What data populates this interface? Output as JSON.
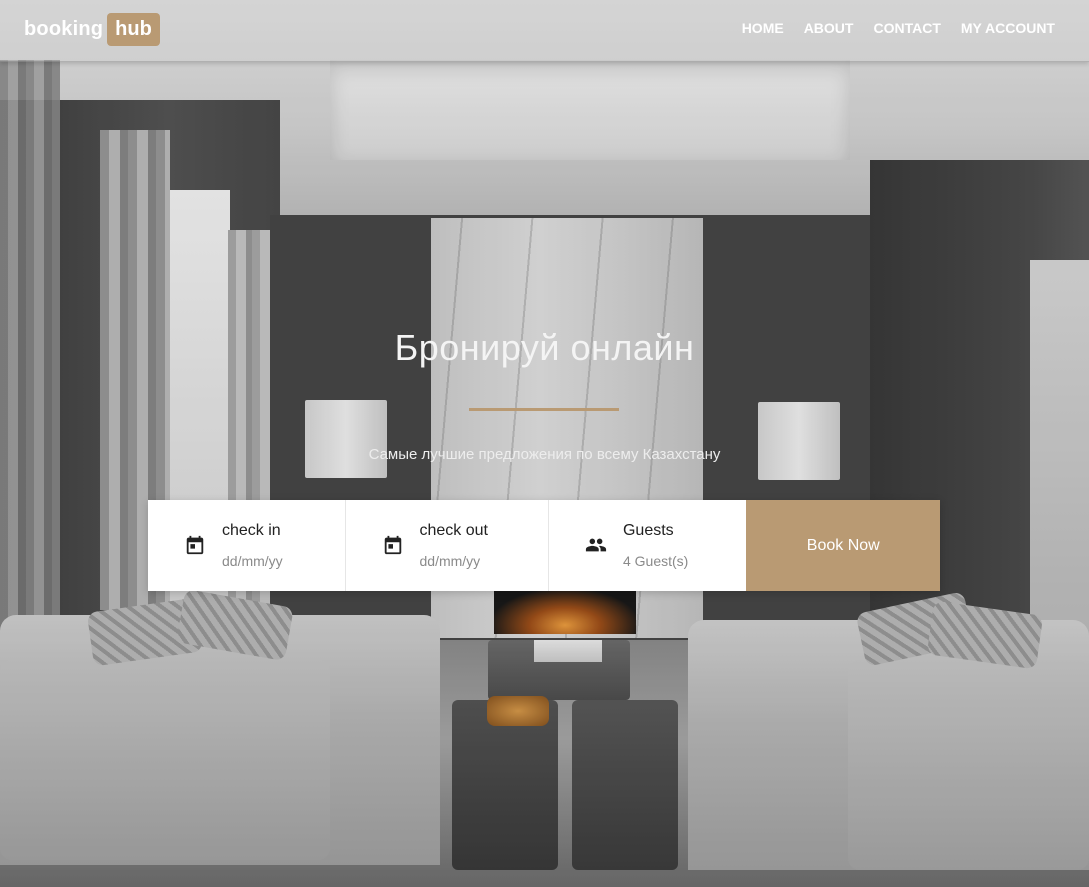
{
  "brand": {
    "name": "booking",
    "badge": "hub",
    "accent_color": "#b99a73"
  },
  "nav": {
    "items": [
      {
        "label": "HOME"
      },
      {
        "label": "ABOUT"
      },
      {
        "label": "CONTACT"
      },
      {
        "label": "MY ACCOUNT"
      }
    ]
  },
  "hero": {
    "title": "Бронируй онлайн",
    "subtitle": "Самые лучшие предложения по всему Казахстану",
    "background_image": "grayscale living-room interior with marble fireplace wall, two sofas, lamps and coffee table"
  },
  "booking": {
    "check_in": {
      "label": "check in",
      "value": "dd/mm/yy",
      "icon": "calendar-icon"
    },
    "check_out": {
      "label": "check out",
      "value": "dd/mm/yy",
      "icon": "calendar-icon"
    },
    "guests": {
      "label": "Guests",
      "value": "4 Guest(s)",
      "icon": "people-icon"
    },
    "submit_label": "Book Now"
  }
}
